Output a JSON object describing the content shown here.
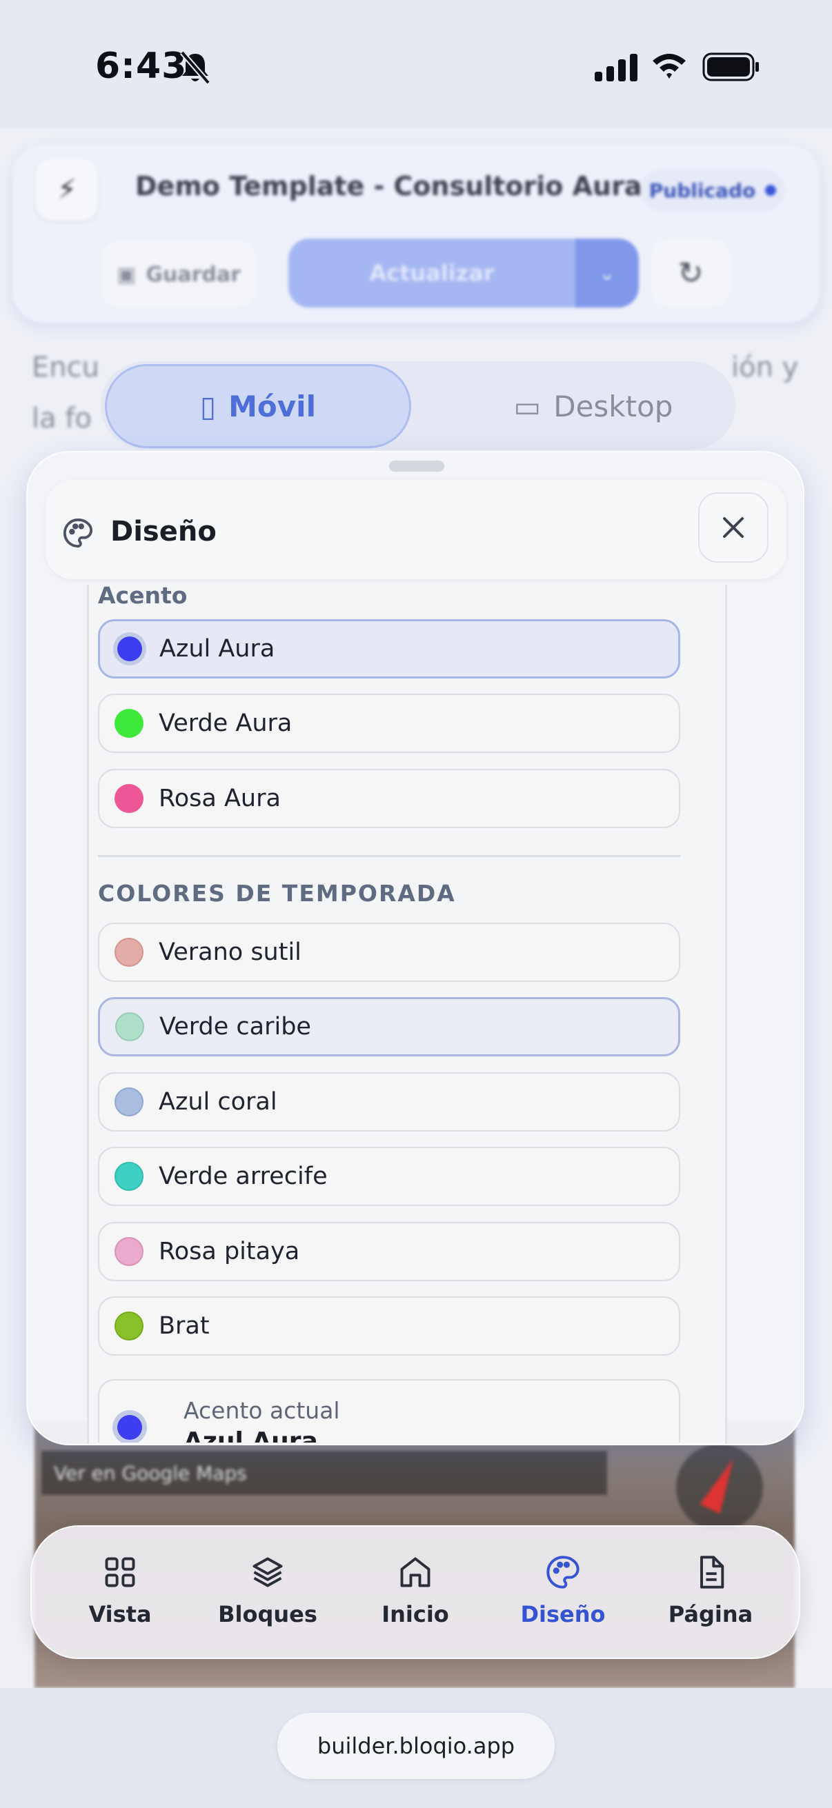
{
  "status_bar": {
    "time": "6:43"
  },
  "background": {
    "site_title": "Demo Template - Consultorio Aura",
    "status_badge": "Publicado",
    "save_label": "Guardar",
    "update_label": "Actualizar",
    "text_fragment_left": "Encu",
    "text_fragment_left2": "la fo",
    "text_fragment_right": "ión y",
    "device_mobile": "Móvil",
    "device_desktop": "Desktop",
    "map_caption": "Ver en Google Maps"
  },
  "sheet": {
    "title": "Diseño",
    "accent_label": "Acento",
    "accent_options": [
      {
        "label": "Azul Aura",
        "color": "#3d3ef0",
        "selected": true
      },
      {
        "label": "Verde Aura",
        "color": "#3ee83a",
        "selected": false
      },
      {
        "label": "Rosa Aura",
        "color": "#ee5795",
        "selected": false
      }
    ],
    "seasonal_label": "COLORES DE TEMPORADA",
    "seasonal_options": [
      {
        "label": "Verano sutil",
        "color": "#e4aca6"
      },
      {
        "label": "Verde caribe",
        "color": "#aedfc9",
        "selected": true
      },
      {
        "label": "Azul coral",
        "color": "#a9bde0"
      },
      {
        "label": "Verde arrecife",
        "color": "#3fd0c4"
      },
      {
        "label": "Rosa pitaya",
        "color": "#eba9cc"
      },
      {
        "label": "Brat",
        "color": "#89c12a"
      }
    ],
    "current_label": "Acento actual",
    "current_value": "Azul Aura"
  },
  "bottom_nav": [
    {
      "label": "Vista",
      "icon": "grid-icon"
    },
    {
      "label": "Bloques",
      "icon": "layers-icon"
    },
    {
      "label": "Inicio",
      "icon": "home-icon"
    },
    {
      "label": "Diseño",
      "icon": "palette-icon",
      "active": true
    },
    {
      "label": "Página",
      "icon": "page-icon"
    }
  ],
  "url": "builder.bloqio.app",
  "colors": {
    "accent": "#3454d1",
    "background": "#e3e6ef"
  }
}
